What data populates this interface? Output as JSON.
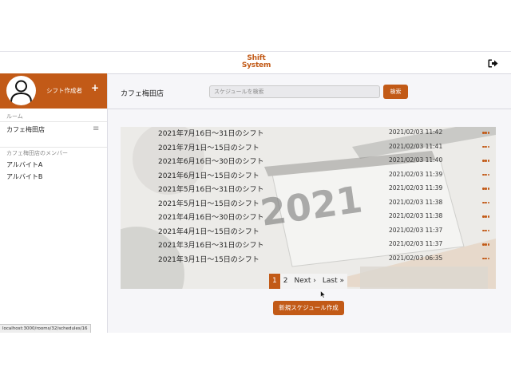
{
  "header": {
    "logo_line1": "Shift",
    "logo_line2": "System",
    "logout_icon": "sign-out-icon"
  },
  "sidebar": {
    "creator_label": "シフト作成者",
    "add_icon": "plus-icon",
    "rooms_heading": "ルーム",
    "room_item": "カフェ梅田店",
    "room_menu_icon": "hamburger-icon",
    "members_heading": "カフェ梅田店のメンバー",
    "members": [
      "アルバイトA",
      "アルバイトB"
    ]
  },
  "main": {
    "room_title": "カフェ梅田店",
    "search_placeholder": "スケジュールを検索",
    "search_button": "検索",
    "schedules": [
      {
        "title": "2021年7月16日〜31日のシフト",
        "date": "2021/02/03 11:42"
      },
      {
        "title": "2021年7月1日〜15日のシフト",
        "date": "2021/02/03 11:41"
      },
      {
        "title": "2021年6月16日〜30日のシフト",
        "date": "2021/02/03 11:40"
      },
      {
        "title": "2021年6月1日〜15日のシフト",
        "date": "2021/02/03 11:39"
      },
      {
        "title": "2021年5月16日〜31日のシフト",
        "date": "2021/02/03 11:39"
      },
      {
        "title": "2021年5月1日〜15日のシフト",
        "date": "2021/02/03 11:38"
      },
      {
        "title": "2021年4月16日〜30日のシフト",
        "date": "2021/02/03 11:38"
      },
      {
        "title": "2021年4月1日〜15日のシフト",
        "date": "2021/02/03 11:37"
      },
      {
        "title": "2021年3月16日〜31日のシフト",
        "date": "2021/02/03 11:37"
      },
      {
        "title": "2021年3月1日〜15日のシフト",
        "date": "2021/02/03 06:35"
      }
    ],
    "background_image_text": "2021",
    "pagination": {
      "page1": "1",
      "page2": "2",
      "next": "Next ›",
      "last": "Last »"
    },
    "new_schedule_button": "新規スケジュール作成"
  },
  "status_bar": {
    "url": "localhost:3000/rooms/32/schedules/16"
  },
  "colors": {
    "accent": "#c25a17",
    "background": "#f6f6f9"
  }
}
